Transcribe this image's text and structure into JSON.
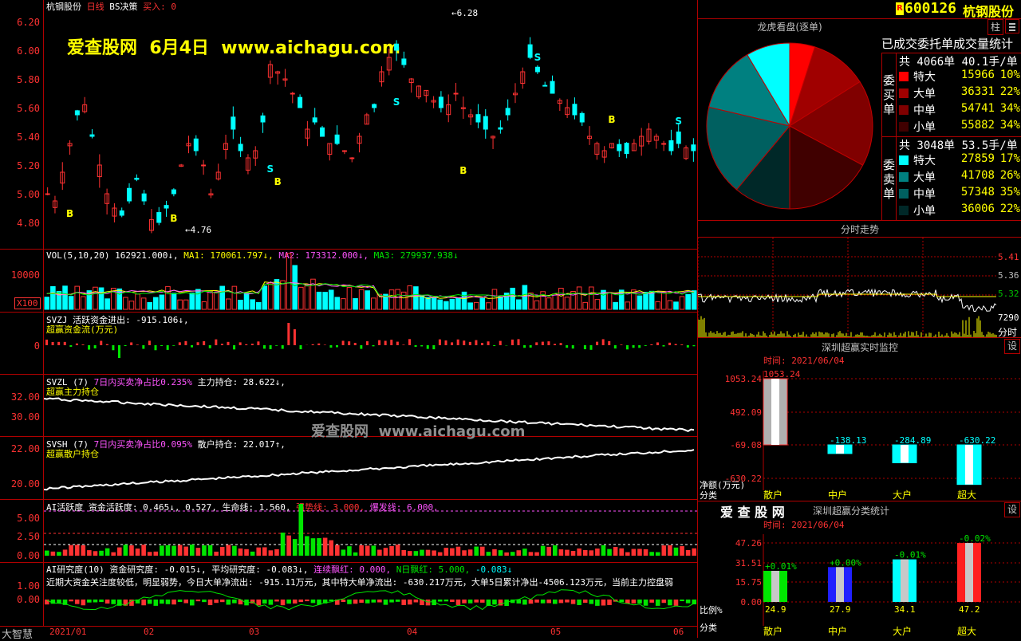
{
  "main": {
    "title_parts": [
      "杭钢股份",
      "日线",
      "BS决策",
      "买入: 0"
    ],
    "watermark": "爱查股网  6月4日  www.aichagu.com",
    "yaxis": [
      "6.20",
      "6.00",
      "5.80",
      "5.60",
      "5.40",
      "5.20",
      "5.00",
      "4.80"
    ],
    "high_label": "6.28",
    "low_label": "4.76",
    "buy_mark": "B",
    "sell_mark": "S"
  },
  "vol": {
    "header": "VOL(5,10,20) 162921.000↓, MA1: 170061.797↓, MA2: 173312.000↓, MA3: 279937.938↓",
    "parts": [
      "VOL(5,10,20) 162921.000↓,",
      "MA1: 170061.797↓,",
      "MA2: 173312.000↓,",
      "MA3: 279937.938↓"
    ],
    "yaxis": [
      "10000"
    ],
    "unit": "X100"
  },
  "svzj": {
    "line1": "SVZJ  活跃资金进出: -915.106↓,",
    "line2": "超赢资金流(万元)",
    "yaxis": [
      "0"
    ]
  },
  "svzl": {
    "parts": [
      "SVZL (7)",
      "7日内买卖净占比0.235%",
      "主力持仓: 28.622↓,"
    ],
    "line2": "超赢主力持仓",
    "yaxis": [
      "32.00",
      "30.00"
    ]
  },
  "svsh": {
    "parts": [
      "SVSH (7)",
      "7日内买卖净占比0.095%",
      "散户持仓: 22.017↑,"
    ],
    "line2": "超赢散户持仓",
    "yaxis": [
      "22.00",
      "20.00"
    ]
  },
  "ai_active": {
    "parts": [
      "AI活跃度",
      "资金活跃度: 0.465↓,",
      "0.527,",
      "生命线: 1.560,",
      "强势线: 3.000,",
      "爆发线: 6.000,"
    ],
    "yaxis": [
      "5.00",
      "2.50",
      "0.00"
    ]
  },
  "ai_research": {
    "parts": [
      "AI研究度(10)",
      "资金研究度: -0.015↓,",
      "平均研究度: -0.083↓,",
      "连续飘红: 0.000,",
      "N日飘红: 5.000,",
      "-0.083↓"
    ],
    "comment": "近期大资金关注度较低，明显弱势，今日大单净流出: -915.11万元，其中特大单净流出: -630.217万元，大单5日累计净出-4506.123万元，当前主力控盘弱",
    "yaxis": [
      "1.00",
      "0.00"
    ],
    "watermark2": "爱查股网  www.aichagu.com"
  },
  "xaxis": [
    "2021/01",
    "02",
    "03",
    "04",
    "05",
    "06"
  ],
  "footer_left": "大智慧",
  "right": {
    "code": "600126",
    "name": "杭钢股份",
    "r_badge": "R",
    "lhkp_title": "龙虎看盘(逐单)",
    "stat_title": "已成交委托单成交量统计",
    "buy_label": [
      "委",
      "买",
      "单"
    ],
    "sell_label": [
      "委",
      "卖",
      "单"
    ],
    "buy_total": "共 4066单 40.1手/单",
    "sell_total": "共 3048单 53.5手/单",
    "buy_rows": [
      {
        "name": "特大",
        "value": "15966",
        "pct": "10%",
        "color": "#ff0000"
      },
      {
        "name": "大单",
        "value": "36331",
        "pct": "22%",
        "color": "#a00000"
      },
      {
        "name": "中单",
        "value": "54741",
        "pct": "34%",
        "color": "#800000"
      },
      {
        "name": "小单",
        "value": "55882",
        "pct": "34%",
        "color": "#400000"
      }
    ],
    "sell_rows": [
      {
        "name": "特大",
        "value": "27859",
        "pct": "17%",
        "color": "#00ffff"
      },
      {
        "name": "大单",
        "value": "41708",
        "pct": "26%",
        "color": "#008080"
      },
      {
        "name": "中单",
        "value": "57348",
        "pct": "35%",
        "color": "#006060"
      },
      {
        "name": "小单",
        "value": "36006",
        "pct": "22%",
        "color": "#002828"
      }
    ],
    "pie_slices": [
      {
        "value": 15966,
        "color": "#ff0000"
      },
      {
        "value": 36331,
        "color": "#a00000"
      },
      {
        "value": 54741,
        "color": "#800000"
      },
      {
        "value": 55882,
        "color": "#400000"
      },
      {
        "value": 36006,
        "color": "#002828"
      },
      {
        "value": 57348,
        "color": "#006060"
      },
      {
        "value": 41708,
        "color": "#008080"
      },
      {
        "value": 27859,
        "color": "#00ffff"
      }
    ],
    "intraday_title": "分时走势",
    "intraday_axis": [
      "5.41",
      "5.36",
      "5.32",
      "7290"
    ],
    "intraday_footer": "分时",
    "monitor_title": "深圳超赢实时监控",
    "monitor_time": "时间: 2021/06/04",
    "monitor_axis": [
      "1053.24",
      "492.09",
      "-69.08",
      "-630.22"
    ],
    "monitor_unit": "净额(万元)",
    "monitor_cat_label": "分类",
    "monitor_bars": [
      {
        "cat": "散户",
        "value": 1053.24,
        "label": "1053.24"
      },
      {
        "cat": "中户",
        "value": -138.13,
        "label": "-138.13"
      },
      {
        "cat": "大户",
        "value": -284.89,
        "label": "-284.89"
      },
      {
        "cat": "超大",
        "value": -630.22,
        "label": "-630.22"
      }
    ],
    "set_btn": "设",
    "pin_btn": "柱",
    "logo": "爱 查 股 网",
    "class_title": "深圳超赢分类统计",
    "class_time": "时间: 2021/06/04",
    "class_axis": [
      "47.26",
      "31.51",
      "15.75",
      "0.00"
    ],
    "class_ratio_label": "比例%",
    "class_cat_label": "分类",
    "class_bars": [
      {
        "cat": "散户",
        "value": 24.9,
        "label": "24.9",
        "change": "+0.01%",
        "color": "#00e600"
      },
      {
        "cat": "中户",
        "value": 27.9,
        "label": "27.9",
        "change": "+0.00%",
        "color": "#2020ff"
      },
      {
        "cat": "大户",
        "value": 34.1,
        "label": "34.1",
        "change": "-0.01%",
        "color": "#00ffff"
      },
      {
        "cat": "超大",
        "value": 47.2,
        "label": "47.2",
        "change": "-0.02%",
        "color": "#ff2020"
      }
    ]
  }
}
